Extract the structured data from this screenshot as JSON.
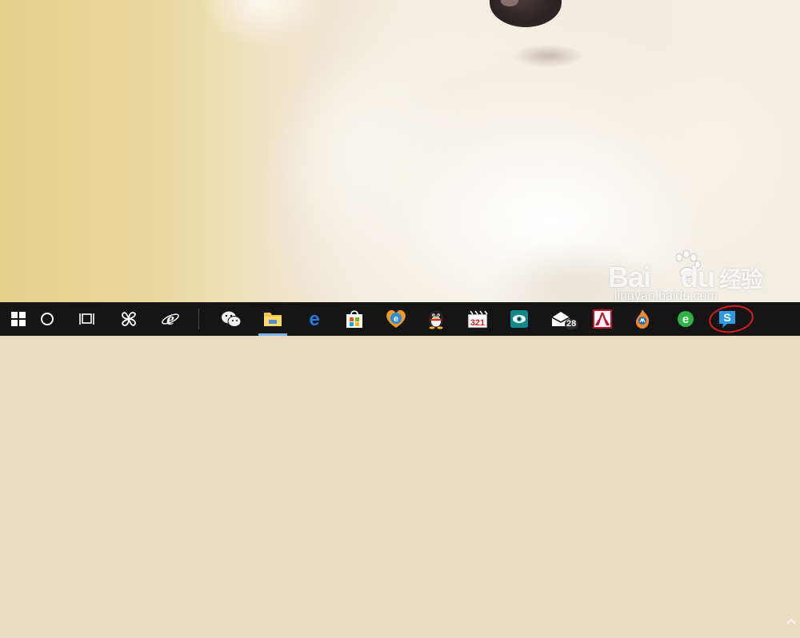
{
  "wallpaper": {
    "subject": "white-puppy"
  },
  "watermark": {
    "brand": "Bai",
    "brand2": "du",
    "brand_cn": "经验",
    "url": "jingyan.baidu.com"
  },
  "taskbar": {
    "items": [
      {
        "name": "start-button",
        "icon": "windows-logo-icon"
      },
      {
        "name": "cortana-button",
        "icon": "circle-icon"
      },
      {
        "name": "task-view-button",
        "icon": "task-view-icon"
      },
      {
        "name": "app-pinwheel",
        "icon": "pinwheel-icon"
      },
      {
        "name": "ie-browser",
        "icon": "ie-icon"
      },
      {
        "name": "wechat",
        "icon": "wechat-icon"
      },
      {
        "name": "file-explorer",
        "icon": "folder-icon",
        "active": true
      },
      {
        "name": "edge-browser",
        "icon": "edge-icon"
      },
      {
        "name": "store",
        "icon": "store-icon"
      },
      {
        "name": "heart-app",
        "icon": "heart-e-icon"
      },
      {
        "name": "qq",
        "icon": "penguin-icon"
      },
      {
        "name": "calendar-app",
        "icon": "clapper-icon",
        "text": "321"
      },
      {
        "name": "eye-app",
        "icon": "eye-icon"
      },
      {
        "name": "mail-app",
        "icon": "mail-icon",
        "badge": "28"
      },
      {
        "name": "red-app",
        "icon": "red-ren-icon"
      },
      {
        "name": "flame-app",
        "icon": "flame-icon"
      },
      {
        "name": "360-browser",
        "icon": "green-e-icon"
      },
      {
        "name": "sogou-app",
        "icon": "s-icon"
      }
    ],
    "colors": {
      "background": "#151515",
      "active_indicator": "#7fb3e8",
      "highlight": "#e0181f"
    }
  },
  "tray": {
    "icon": "chevron-up-icon"
  }
}
